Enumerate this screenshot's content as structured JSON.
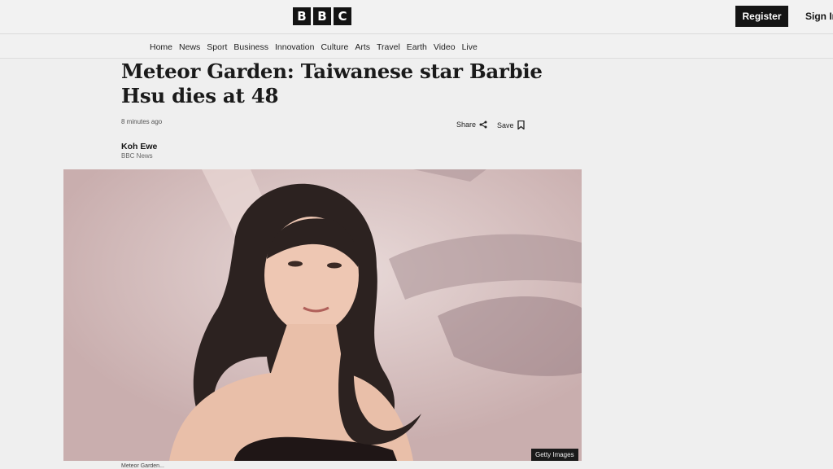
{
  "header": {
    "logo_letters": [
      "B",
      "B",
      "C"
    ],
    "register_label": "Register",
    "signin_label": "Sign In"
  },
  "nav": {
    "items": [
      "Home",
      "News",
      "Sport",
      "Business",
      "Innovation",
      "Culture",
      "Arts",
      "Travel",
      "Earth",
      "Video",
      "Live"
    ]
  },
  "article": {
    "headline": "Meteor Garden: Taiwanese star Barbie Hsu dies at 48",
    "timestamp": "8 minutes ago",
    "share_label": "Share",
    "save_label": "Save",
    "author": "Koh Ewe",
    "organization": "BBC News",
    "image_credit": "Getty Images",
    "caption": "Meteor Garden..."
  },
  "colors": {
    "brand_black": "#141414",
    "background": "#efefef"
  },
  "icons": [
    "share-icon",
    "bookmark-icon"
  ]
}
